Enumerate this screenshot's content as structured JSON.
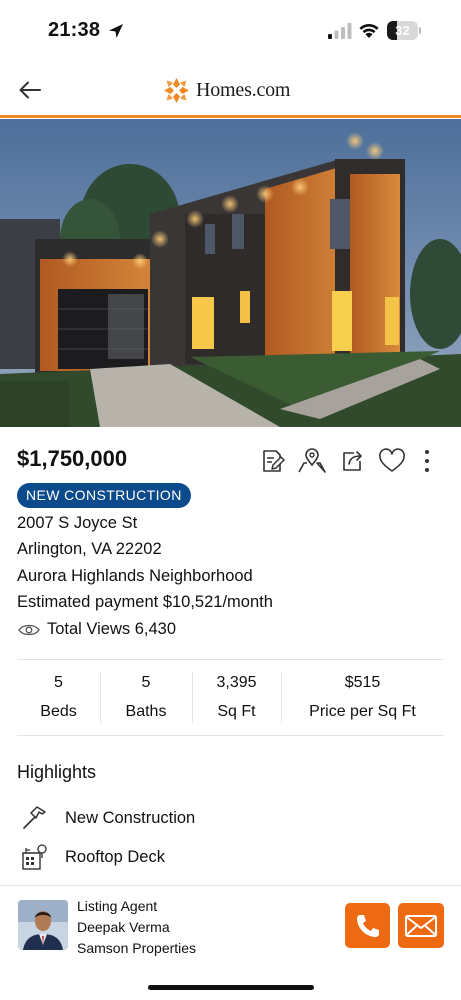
{
  "status_bar": {
    "time": "21:38",
    "battery_level": "32",
    "icons": [
      "location-arrow-icon",
      "signal-icon",
      "wifi-icon",
      "battery-icon"
    ]
  },
  "nav": {
    "back_icon": "arrow-left-icon",
    "brand_name": "Homes.com",
    "brand_color": "#f08a24"
  },
  "listing": {
    "photo_description": "photo",
    "price": "$1,750,000",
    "badge": "NEW CONSTRUCTION",
    "address_line1": "2007 S Joyce St",
    "address_line2": "Arlington, VA 22202",
    "neighborhood": "Aurora Highlands Neighborhood",
    "estimated_payment": "Estimated payment $10,521/month",
    "total_views": "Total Views 6,430",
    "actions": [
      "notes-icon",
      "map-pin-icon",
      "share-icon",
      "heart-icon",
      "more-vertical-icon"
    ]
  },
  "stats": [
    {
      "value": "5",
      "label": "Beds"
    },
    {
      "value": "5",
      "label": "Baths"
    },
    {
      "value": "3,395",
      "label": "Sq Ft"
    },
    {
      "value": "$515",
      "label": "Price per Sq Ft"
    }
  ],
  "highlights": {
    "title": "Highlights",
    "items": [
      {
        "label": "New Construction",
        "icon": "hammer-icon"
      },
      {
        "label": "Rooftop Deck",
        "icon": "building-tree-icon"
      }
    ]
  },
  "agent": {
    "role": "Listing Agent",
    "name": "Deepak Verma",
    "company": "Samson Properties",
    "call_icon": "phone-icon",
    "email_icon": "envelope-icon",
    "accent_color": "#ee6a12"
  },
  "colors": {
    "badge": "#0b4a8b",
    "text": "#111111"
  }
}
